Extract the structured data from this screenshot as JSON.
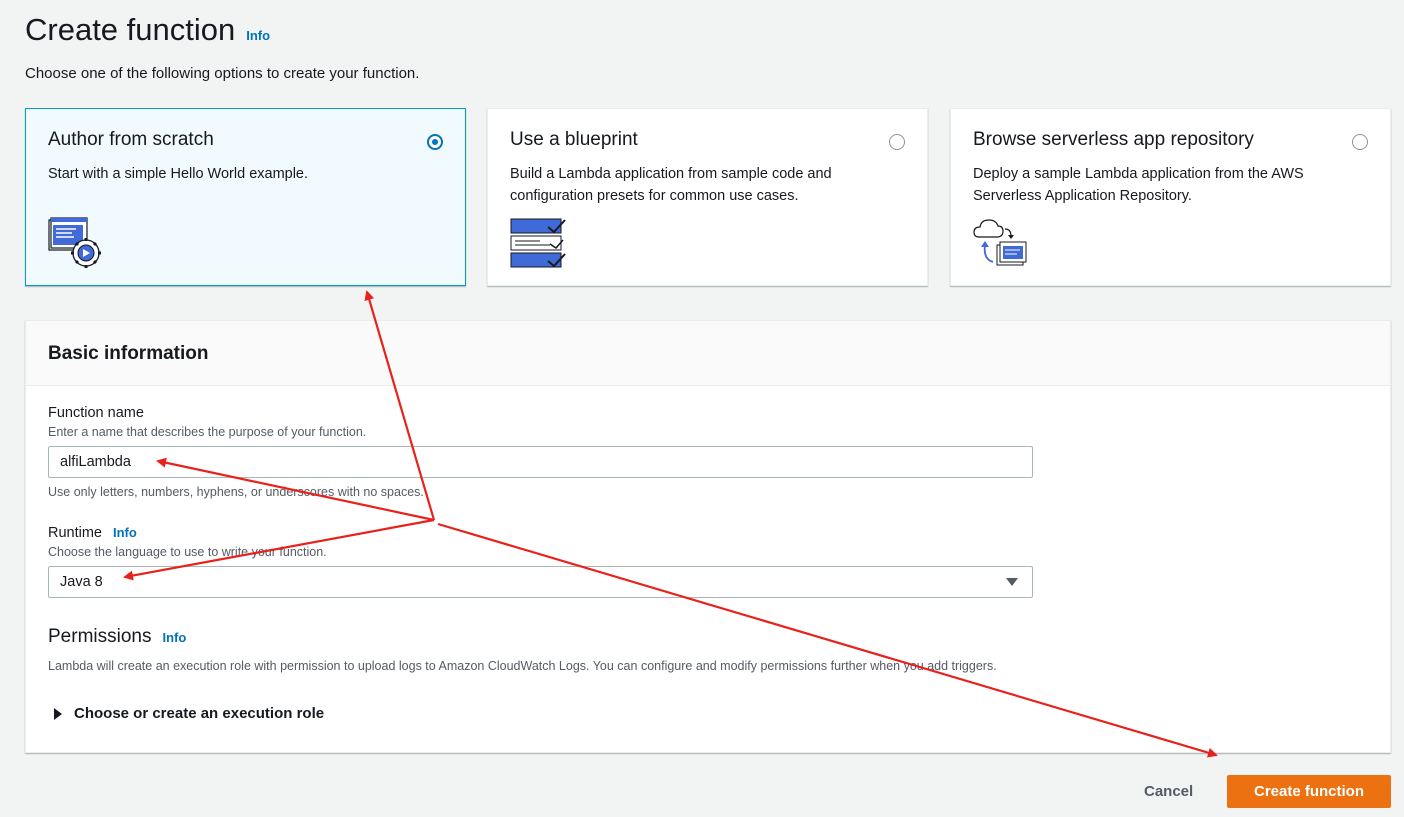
{
  "header": {
    "title": "Create function",
    "info": "Info",
    "subtitle": "Choose one of the following options to create your function."
  },
  "options": [
    {
      "title": "Author from scratch",
      "description": "Start with a simple Hello World example.",
      "selected": true,
      "icon": "code-gear-icon"
    },
    {
      "title": "Use a blueprint",
      "description": "Build a Lambda application from sample code and configuration presets for common use cases.",
      "selected": false,
      "icon": "blueprint-icon"
    },
    {
      "title": "Browse serverless app repository",
      "description": "Deploy a sample Lambda application from the AWS Serverless Application Repository.",
      "selected": false,
      "icon": "cloud-repository-icon"
    }
  ],
  "basic_info": {
    "title": "Basic information",
    "function_name": {
      "label": "Function name",
      "description": "Enter a name that describes the purpose of your function.",
      "value": "alfiLambda",
      "constraint": "Use only letters, numbers, hyphens, or underscores with no spaces."
    },
    "runtime": {
      "label": "Runtime",
      "info": "Info",
      "description": "Choose the language to use to write your function.",
      "value": "Java 8"
    },
    "permissions": {
      "title": "Permissions",
      "info": "Info",
      "description": "Lambda will create an execution role with permission to upload logs to Amazon CloudWatch Logs. You can configure and modify permissions further when you add triggers.",
      "expander": "Choose or create an execution role"
    }
  },
  "footer": {
    "cancel": "Cancel",
    "create": "Create function"
  },
  "colors": {
    "accent": "#0073bb",
    "primary_button": "#ec7211",
    "annotation_arrow": "#e8221b"
  }
}
